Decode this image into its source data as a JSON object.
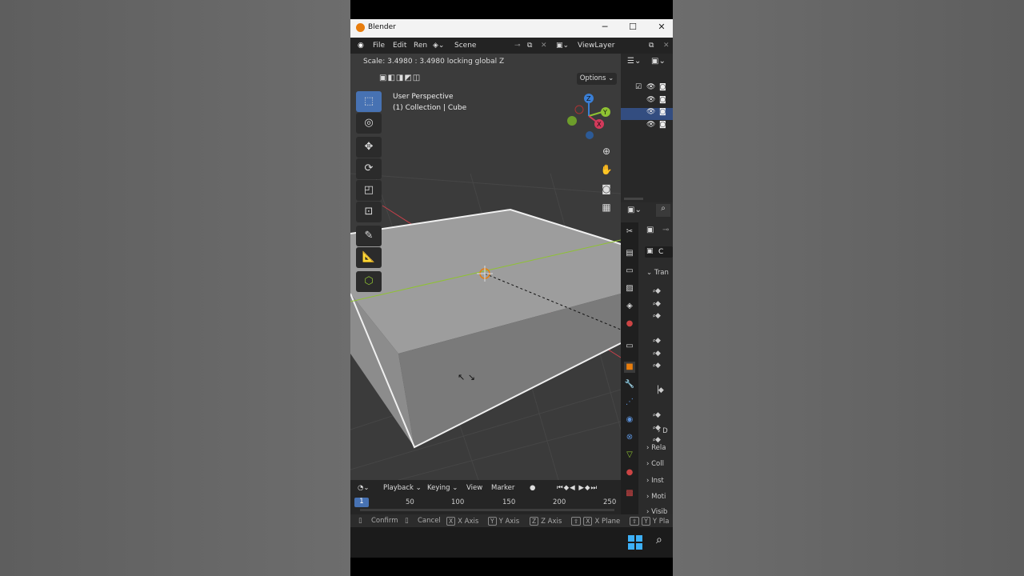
{
  "window": {
    "title": "Blender",
    "minimize": "─",
    "maximize": "☐",
    "close": "✕"
  },
  "menu": {
    "file": "File",
    "edit": "Edit",
    "render": "Ren",
    "scene": "Scene",
    "view_layer": "ViewLayer"
  },
  "viewport": {
    "status": "Scale: 3.4980 : 3.4980 locking global Z",
    "options": "Options",
    "perspective": "User Perspective",
    "collection": "(1) Collection | Cube",
    "gizmo": {
      "z": "Z",
      "y": "Y",
      "x": "X"
    }
  },
  "tools": [
    "select-box",
    "cursor",
    "move",
    "rotate",
    "scale",
    "transform",
    "annotate",
    "measure",
    "add-cube"
  ],
  "timeline": {
    "playback": "Playback",
    "keying": "Keying",
    "view": "View",
    "marker": "Marker",
    "current_frame": "1",
    "ticks": [
      "50",
      "100",
      "150",
      "200",
      "250"
    ]
  },
  "properties": {
    "object_name": "C",
    "transform": "Tran",
    "delta": "D",
    "relations": "Rela",
    "collections": "Coll",
    "instancing": "Inst",
    "motion": "Moti",
    "visibility": "Visib"
  },
  "status_bar": {
    "confirm": "Confirm",
    "cancel": "Cancel",
    "x_key": "X",
    "x_axis": "X Axis",
    "y_key": "Y",
    "y_axis": "Y Axis",
    "z_key": "Z",
    "z_axis": "Z Axis",
    "shift_key": "⇧",
    "x_plane": "X Plane",
    "y_plane": "Y Pla"
  },
  "colors": {
    "accent": "#4772b3",
    "x_axis": "#d33a5b",
    "y_axis": "#8fc232",
    "z_axis": "#3a7fd6",
    "origin": "#e87d0d"
  }
}
